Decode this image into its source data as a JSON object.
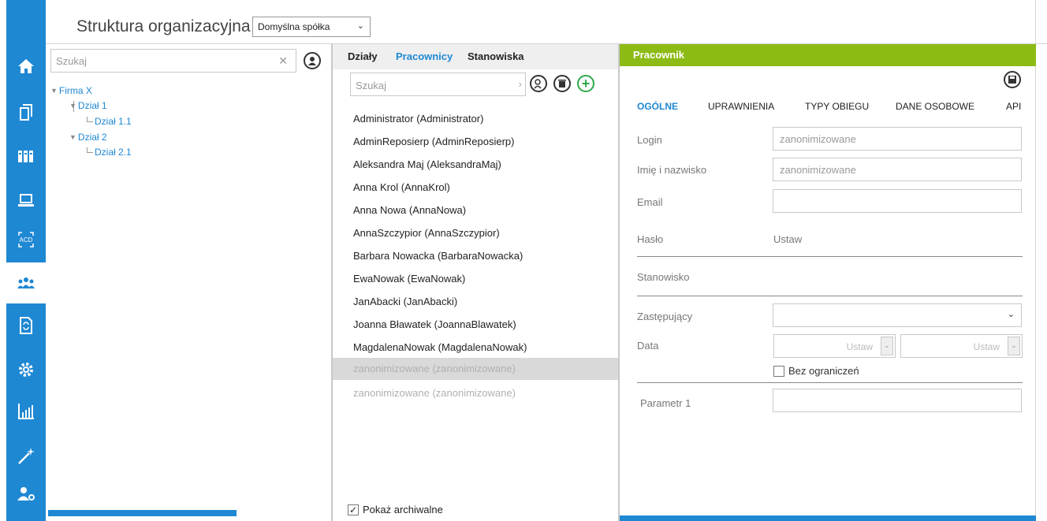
{
  "nav": {
    "items": [
      "home-icon",
      "documents-icon",
      "binders-icon",
      "laptop-icon",
      "acd-icon",
      "users-icon",
      "refresh-document-icon",
      "gear-icon",
      "chart-icon",
      "wand-icon",
      "user-settings-icon"
    ],
    "acd_text": "ACD",
    "active_index": 5,
    "color": "#1e88d3"
  },
  "header": {
    "title": "Struktura organizacyjna",
    "company": "Domyślna spółka"
  },
  "tree": {
    "search_placeholder": "Szukaj",
    "nodes": [
      "Firma X",
      "Dział 1",
      "Dział 1.1",
      "Dział 2",
      "Dział 2.1"
    ]
  },
  "list": {
    "tabs": [
      "Działy",
      "Pracownicy",
      "Stanowiska"
    ],
    "active_tab": "Pracownicy",
    "search_placeholder": "Szukaj",
    "employees": [
      "Administrator (Administrator)",
      "AdminReposierp (AdminReposierp)",
      "Aleksandra Maj (AleksandraMaj)",
      "Anna Krol (AnnaKrol)",
      "Anna Nowa (AnnaNowa)",
      "AnnaSzczypior (AnnaSzczypior)",
      "Barbara Nowacka (BarbaraNowacka)",
      "EwaNowak (EwaNowak)",
      "JanAbacki (JanAbacki)",
      "Joanna Bławatek (JoannaBlawatek)",
      "MagdalenaNowak (MagdalenaNowak)",
      "zanonimizowane (zanonimizowane)",
      "zanonimizowane (zanonimizowane)"
    ],
    "show_archived_label": "Pokaż archiwalne",
    "show_archived_checked": true
  },
  "form": {
    "header": "Pracownik",
    "header_color": "#8dbb16",
    "tabs": [
      "OGÓLNE",
      "UPRAWNIENIA",
      "TYPY OBIEGU",
      "DANE OSOBOWE",
      "API"
    ],
    "active_tab": "OGÓLNE",
    "login_label": "Login",
    "login_value": "zanonimizowane",
    "name_label": "Imię i nazwisko",
    "name_value": "zanonimizowane",
    "email_label": "Email",
    "email_value": "",
    "password_label": "Hasło",
    "password_value": "Ustaw",
    "position_label": "Stanowisko",
    "substitute_label": "Zastępujący",
    "substitute_value": "",
    "date_label": "Data",
    "date_from": "Ustaw",
    "date_to": "Ustaw",
    "unlimited_label": "Bez ograniczeń",
    "unlimited_checked": false,
    "param1_label": "Parametr 1",
    "param1_value": ""
  }
}
